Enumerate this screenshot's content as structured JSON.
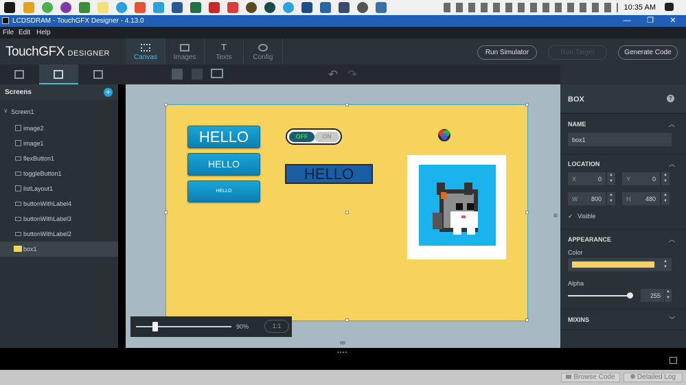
{
  "taskbar": {
    "clock": "10:35 AM"
  },
  "window": {
    "title": "LCDSDRAM - TouchGFX Designer - 4.13.0",
    "minimize": "—",
    "restore": "❐",
    "close": "✕"
  },
  "menu": {
    "file": "File",
    "edit": "Edit",
    "help": "Help"
  },
  "header": {
    "logo_main": "TouchGFX",
    "logo_sub": "DESIGNER",
    "tabs": [
      "Canvas",
      "Images",
      "Texts",
      "Config"
    ],
    "run_simulator": "Run Simulator",
    "run_target": "Run Target",
    "generate_code": "Generate Code"
  },
  "screens": {
    "title": "Screens",
    "screen": "Screen1",
    "widgets": [
      "image2",
      "image1",
      "flexButton1",
      "toggleButton1",
      "listLayout1",
      "buttonWithLabel4",
      "buttonWithLabel3",
      "buttonWithLabel2",
      "box1"
    ],
    "selected": "box1"
  },
  "canvas": {
    "buttons": [
      "HELLO",
      "HELLO",
      "HELLO"
    ],
    "toggle_off": "OFF",
    "toggle_on": "ON",
    "label": "HELLO",
    "zoom_percent": "90%",
    "zoom_ratio": "1:1",
    "zoom_level": 0.2
  },
  "properties": {
    "title": "BOX",
    "help": "?",
    "name_section": "NAME",
    "name_value": "box1",
    "location_section": "LOCATION",
    "x_label": "X",
    "x_value": "0",
    "y_label": "Y",
    "y_value": "0",
    "w_label": "W",
    "w_value": "800",
    "h_label": "H",
    "h_value": "480",
    "visible_label": "Visible",
    "appearance_section": "APPEARANCE",
    "color_label": "Color",
    "color_value": "#f6d35c",
    "alpha_label": "Alpha",
    "alpha_value": "255",
    "mixins_section": "MIXINS"
  },
  "status": {
    "browse_code": "Browse Code",
    "detailed_log": "Detailed Log"
  }
}
